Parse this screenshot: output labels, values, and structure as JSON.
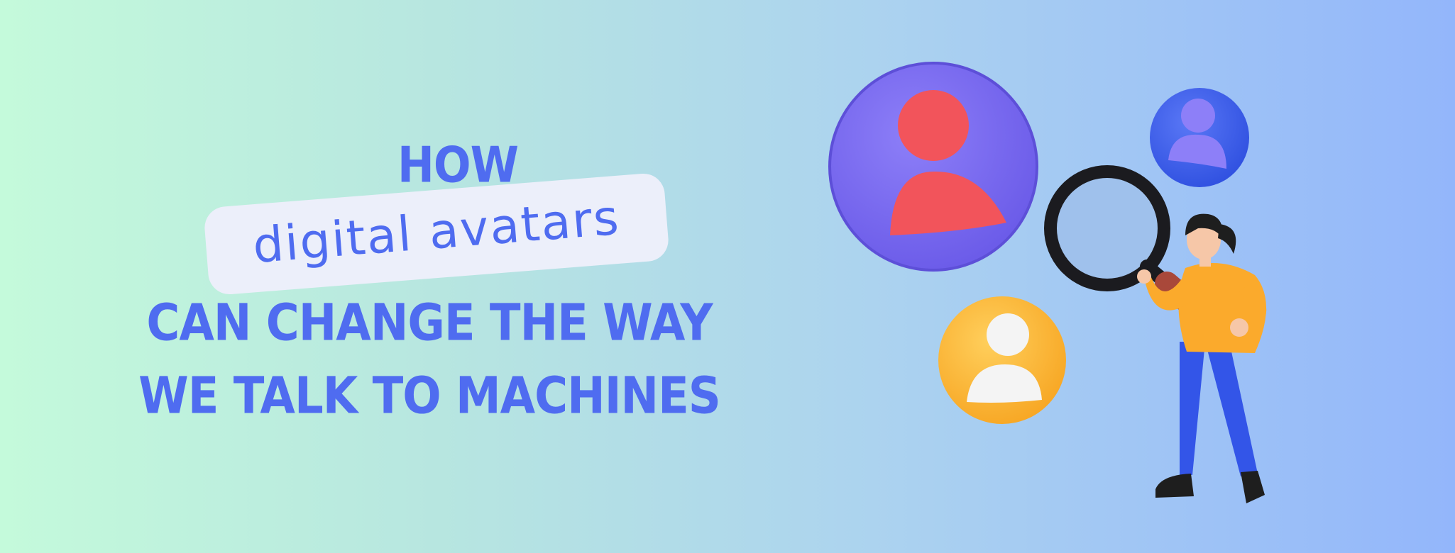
{
  "headline": {
    "line_how": "HOW",
    "highlight": "digital avatars",
    "line_1": "CAN CHANGE THE WAY",
    "line_2": "WE TALK TO MACHINES"
  },
  "colors": {
    "text": "#4f6cf0",
    "pill": "#eceffa",
    "gradient_start": "#c4fadb",
    "gradient_end": "#93b6fb",
    "circle_purple": "#7b6cf5",
    "circle_blue": "#3f61f0",
    "circle_yellow": "#ffbc3b"
  },
  "illustration": {
    "icons": [
      "user-icon-red",
      "user-icon-purple",
      "user-icon-white",
      "magnifying-glass-icon"
    ]
  }
}
